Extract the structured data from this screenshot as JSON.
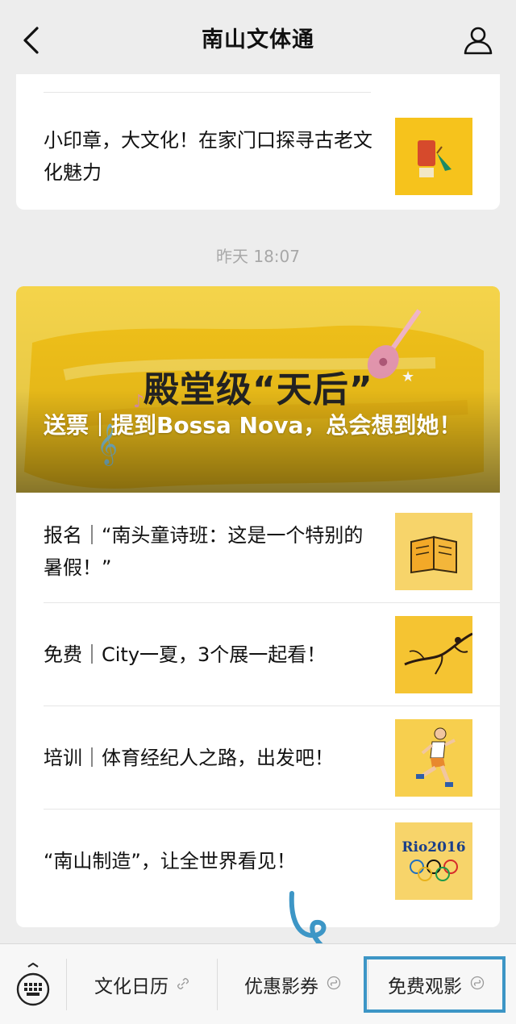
{
  "header": {
    "title": "南山文体通"
  },
  "articles_top": [
    {
      "title": "小印章，大文化！在家门口探寻古老文化魅力"
    }
  ],
  "timestamp": "昨天 18:07",
  "featured": {
    "banner_text": "殿堂级“天后”",
    "caption": "送票｜提到Bossa Nova，总会想到她！"
  },
  "articles": [
    {
      "title": "报名｜“南头童诗班：这是一个特别的暑假！”"
    },
    {
      "title": "免费｜City一夏，3个展一起看！"
    },
    {
      "title": "培训｜体育经纪人之路，出发吧！"
    },
    {
      "title": "“南山制造”，让全世界看见！"
    }
  ],
  "rio_logo_text": "Rio2016",
  "bottom_menu": [
    {
      "label": "文化日历"
    },
    {
      "label": "优惠影券"
    },
    {
      "label": "免费观影"
    }
  ],
  "colors": {
    "accent_yellow": "#f6c31c",
    "highlight_blue": "#3d96c6"
  }
}
